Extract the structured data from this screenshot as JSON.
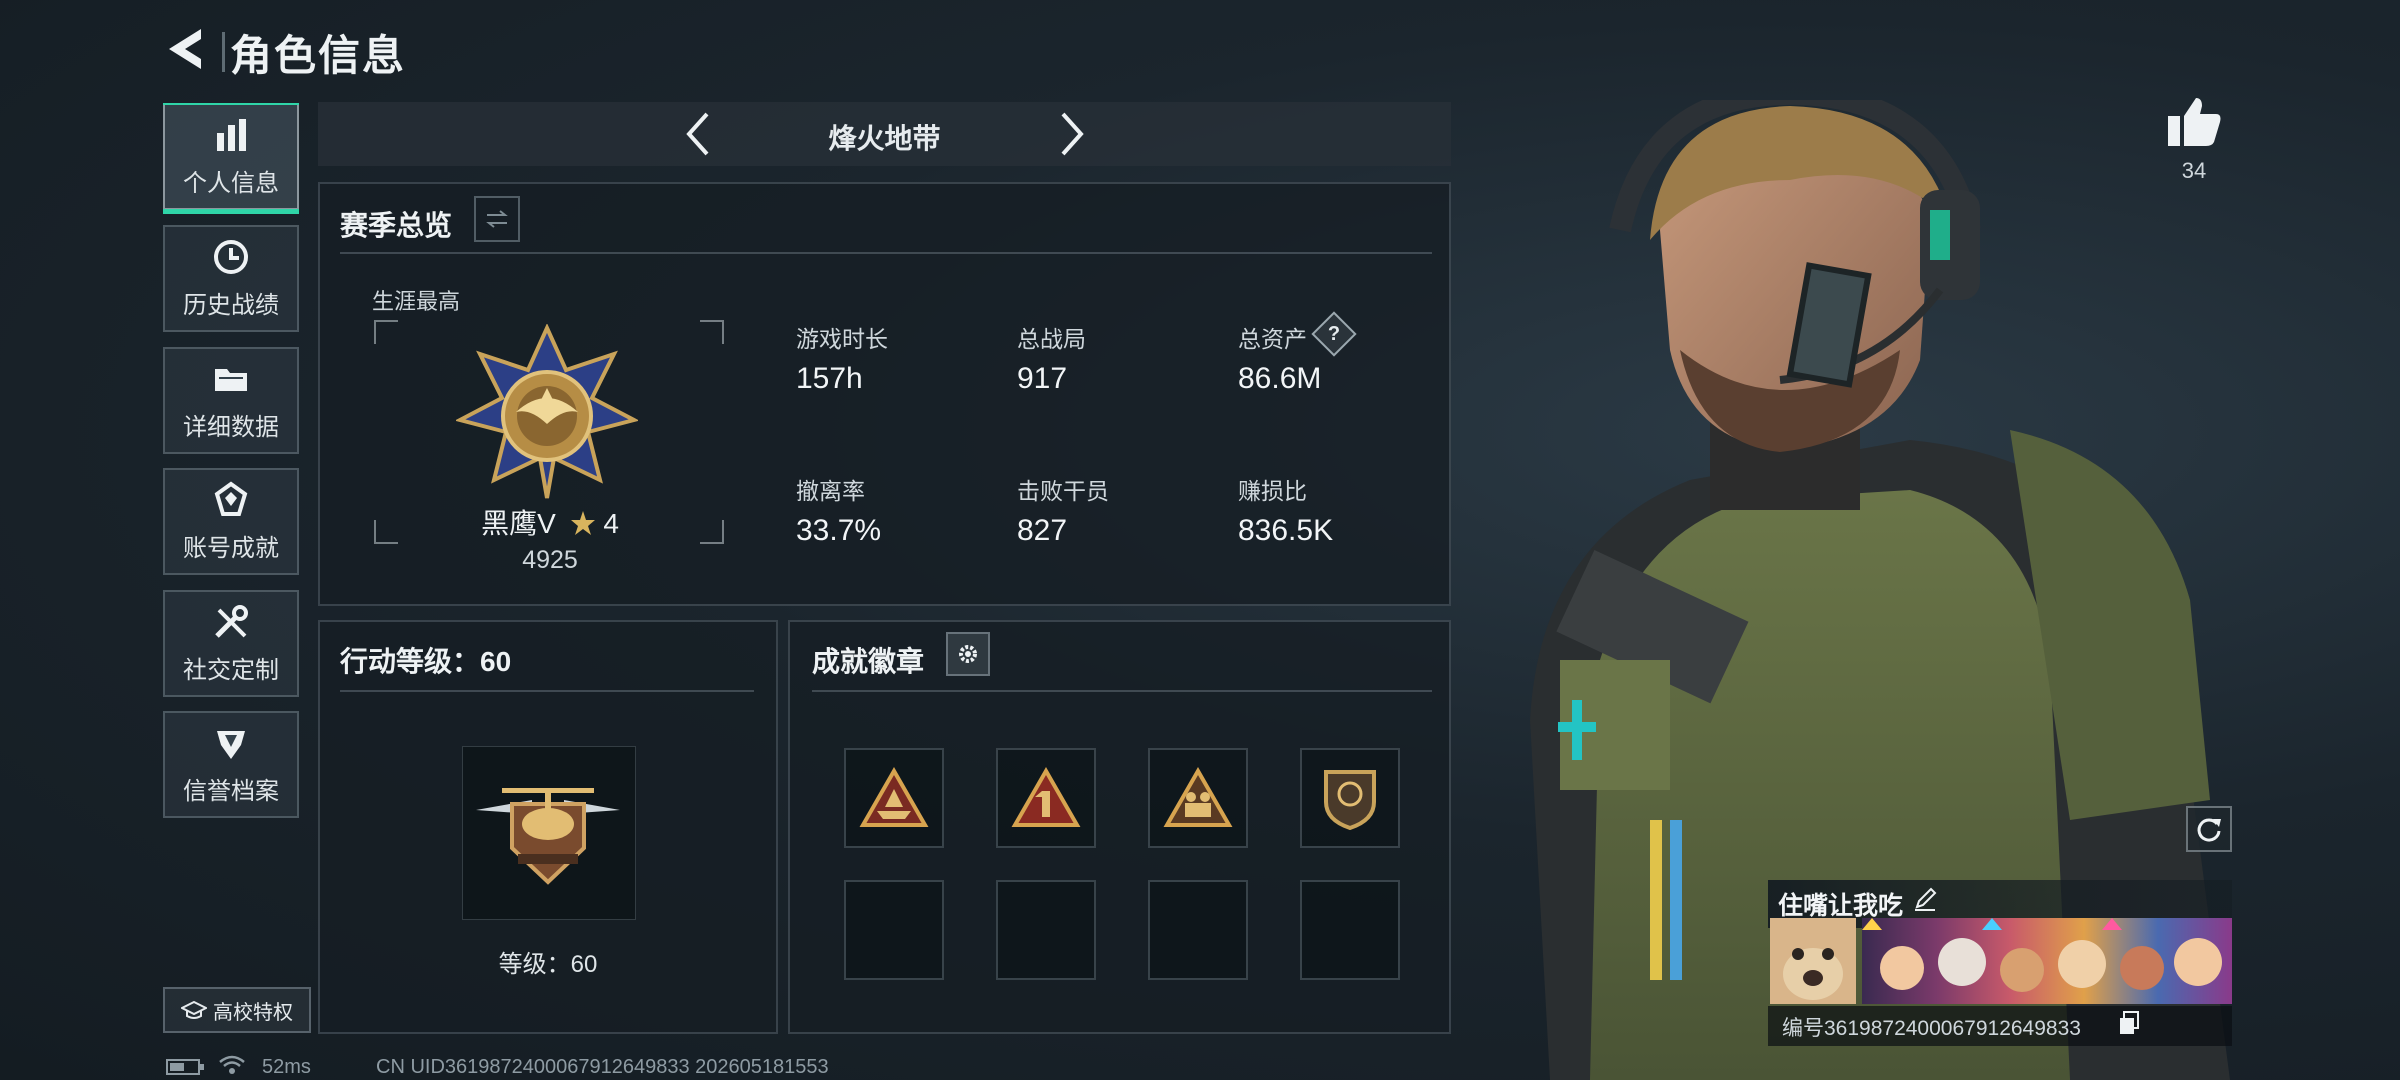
{
  "header": {
    "title": "角色信息"
  },
  "sidebar": {
    "items": [
      {
        "label": "个人信息",
        "icon": "bar-chart-icon",
        "active": true
      },
      {
        "label": "历史战绩",
        "icon": "clock-icon",
        "active": false
      },
      {
        "label": "详细数据",
        "icon": "folder-icon",
        "active": false
      },
      {
        "label": "账号成就",
        "icon": "achievement-icon",
        "active": false
      },
      {
        "label": "社交定制",
        "icon": "tools-icon",
        "active": false
      },
      {
        "label": "信誉档案",
        "icon": "shield-badge-icon",
        "active": false
      }
    ],
    "campus_label": "高校特权"
  },
  "mode": {
    "title": "烽火地带"
  },
  "season": {
    "title": "赛季总览",
    "career_label": "生涯最高",
    "rank_name": "黑鹰V",
    "rank_stars": "4",
    "rank_score": "4925",
    "stats": [
      {
        "label": "游戏时长",
        "value": "157h"
      },
      {
        "label": "总战局",
        "value": "917"
      },
      {
        "label": "总资产",
        "value": "86.6M",
        "help": "?"
      },
      {
        "label": "撤离率",
        "value": "33.7%"
      },
      {
        "label": "击败干员",
        "value": "827"
      },
      {
        "label": "赚损比",
        "value": "836.5K"
      }
    ]
  },
  "action_level": {
    "title": "行动等级：60",
    "level_label": "等级：60"
  },
  "achievements": {
    "title": "成就徽章",
    "badges": [
      "triangle-ship-badge",
      "triangle-one-badge",
      "triangle-figures-badge",
      "shield-head-badge"
    ]
  },
  "likes": {
    "count": "34"
  },
  "profile": {
    "name": "住嘴让我吃",
    "id_text": "编号3619872400067912649833"
  },
  "status_bar": {
    "ping": "52ms",
    "uid_text": "CN UID3619872400067912649833 202605181553"
  },
  "colors": {
    "accent": "#2fd5a8",
    "gold": "#c9a35a"
  }
}
